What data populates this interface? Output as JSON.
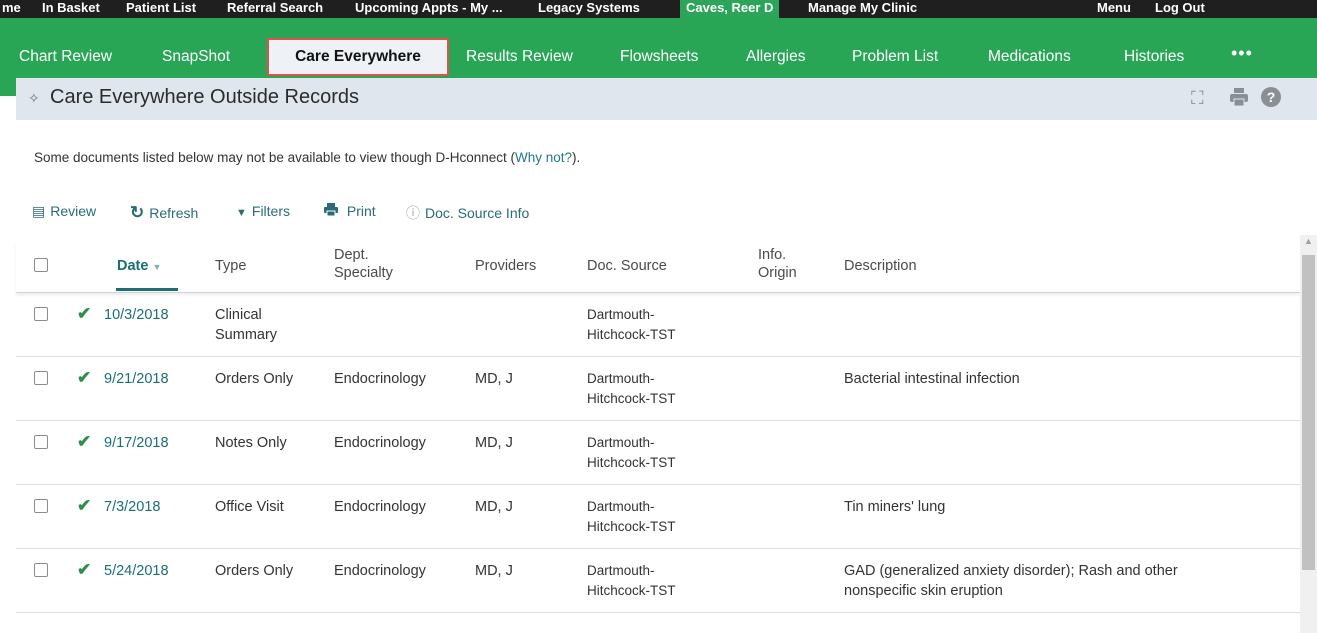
{
  "topnav": {
    "items": [
      "me",
      "In Basket",
      "Patient List",
      "Referral Search",
      "Upcoming Appts - My ...",
      "Legacy Systems"
    ],
    "patient": "Caves, Reer D",
    "manage": "Manage My Clinic",
    "menu": "Menu",
    "logout": "Log Out"
  },
  "tabs": {
    "chart_review": "Chart Review",
    "snapshot": "SnapShot",
    "care_everywhere": "Care Everywhere",
    "results_review": "Results Review",
    "flowsheets": "Flowsheets",
    "allergies": "Allergies",
    "problem_list": "Problem List",
    "medications": "Medications",
    "histories": "Histories",
    "more": "•••",
    "pin_glyph": "⇞"
  },
  "page": {
    "title": "Care Everywhere Outside Records",
    "notice_text": "Some documents listed below may not be available to view though D-Hconnect (",
    "notice_link": "Why not?",
    "notice_end": ")."
  },
  "toolbar": {
    "review": "Review",
    "refresh": "Refresh",
    "filters": "Filters",
    "print": "Print",
    "doc_source_info": "Doc. Source Info"
  },
  "table": {
    "headers": {
      "date": "Date",
      "type": "Type",
      "dept_line1": "Dept.",
      "dept_line2": "Specialty",
      "providers": "Providers",
      "doc_source": "Doc. Source",
      "info_line1": "Info.",
      "info_line2": "Origin",
      "description": "Description"
    },
    "rows": [
      {
        "date": "10/3/2018",
        "type1": "Clinical",
        "type2": "Summary",
        "dept": "",
        "providers": "",
        "src1": "Dartmouth-",
        "src2": "Hitchcock-TST",
        "desc1": "",
        "desc2": ""
      },
      {
        "date": "9/21/2018",
        "type1": "Orders Only",
        "type2": "",
        "dept": "Endocrinology",
        "providers": "MD, J",
        "src1": "Dartmouth-",
        "src2": "Hitchcock-TST",
        "desc1": "Bacterial intestinal infection",
        "desc2": ""
      },
      {
        "date": "9/17/2018",
        "type1": "Notes Only",
        "type2": "",
        "dept": "Endocrinology",
        "providers": "MD, J",
        "src1": "Dartmouth-",
        "src2": "Hitchcock-TST",
        "desc1": "",
        "desc2": ""
      },
      {
        "date": "7/3/2018",
        "type1": "Office Visit",
        "type2": "",
        "dept": "Endocrinology",
        "providers": "MD, J",
        "src1": "Dartmouth-",
        "src2": "Hitchcock-TST",
        "desc1": "Tin miners' lung",
        "desc2": ""
      },
      {
        "date": "5/24/2018",
        "type1": "Orders Only",
        "type2": "",
        "dept": "Endocrinology",
        "providers": "MD, J",
        "src1": "Dartmouth-",
        "src2": "Hitchcock-TST",
        "desc1": "GAD (generalized anxiety disorder); Rash and other",
        "desc2": "nonspecific skin eruption"
      }
    ]
  },
  "icons": {
    "check": "✔",
    "sort_down": "▼",
    "star": "✧",
    "expand": "⛶",
    "print": "🖶",
    "help": "?",
    "refresh": "↻",
    "filter": "▼",
    "info": "ⓘ",
    "review": "▤",
    "scroll_up": "▲"
  },
  "colors": {
    "tab_green": "#28a656",
    "link_teal": "#1b6f70",
    "active_outline": "#d9534f"
  }
}
